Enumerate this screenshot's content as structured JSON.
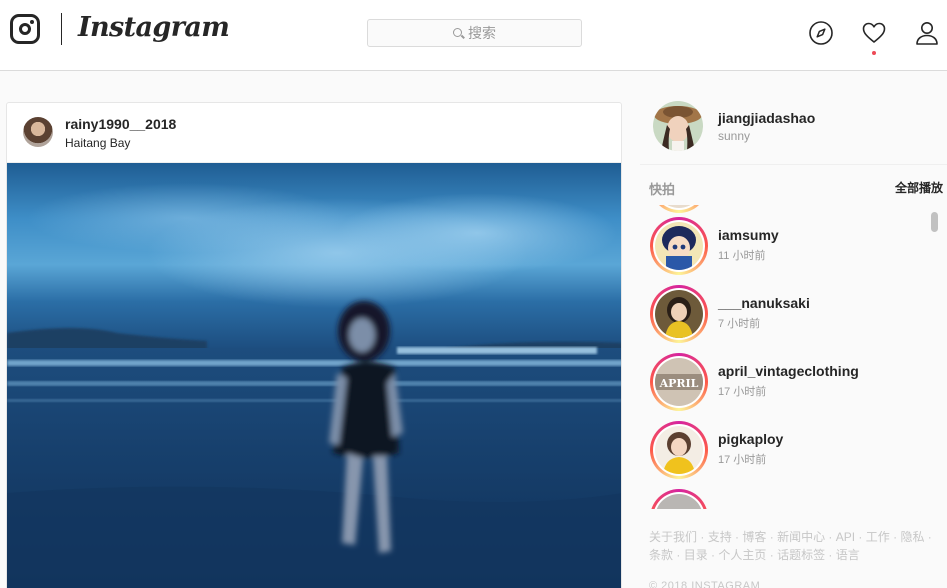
{
  "nav": {
    "wordmark": "Instagram",
    "search_placeholder": "搜索",
    "icons": [
      "instagram-glyph-icon",
      "search-icon",
      "compass-icon",
      "heart-icon",
      "user-icon"
    ],
    "has_notification": true
  },
  "post": {
    "username": "rainy1990__2018",
    "location": "Haitang Bay"
  },
  "profile": {
    "username": "jiangjiadashao",
    "fullname": "sunny"
  },
  "stories": {
    "title": "快拍",
    "watch_all": "全部播放",
    "items": [
      {
        "username": "iamsumy",
        "time": "11 小时前"
      },
      {
        "username": "___nanuksaki",
        "time": "7 小时前"
      },
      {
        "username": "april_vintageclothing",
        "time": "17 小时前"
      },
      {
        "username": "pigkaploy",
        "time": "17 小时前"
      }
    ]
  },
  "footer": {
    "links": [
      "关于我们",
      "支持",
      "博客",
      "新闻中心",
      "API",
      "工作",
      "隐私",
      "条款",
      "目录",
      "个人主页",
      "话题标签",
      "语言"
    ],
    "copyright": "© 2018 INSTAGRAM"
  },
  "colors": {
    "notification": "#ed4956",
    "muted_text": "#999999",
    "border": "#dbdbdb"
  }
}
